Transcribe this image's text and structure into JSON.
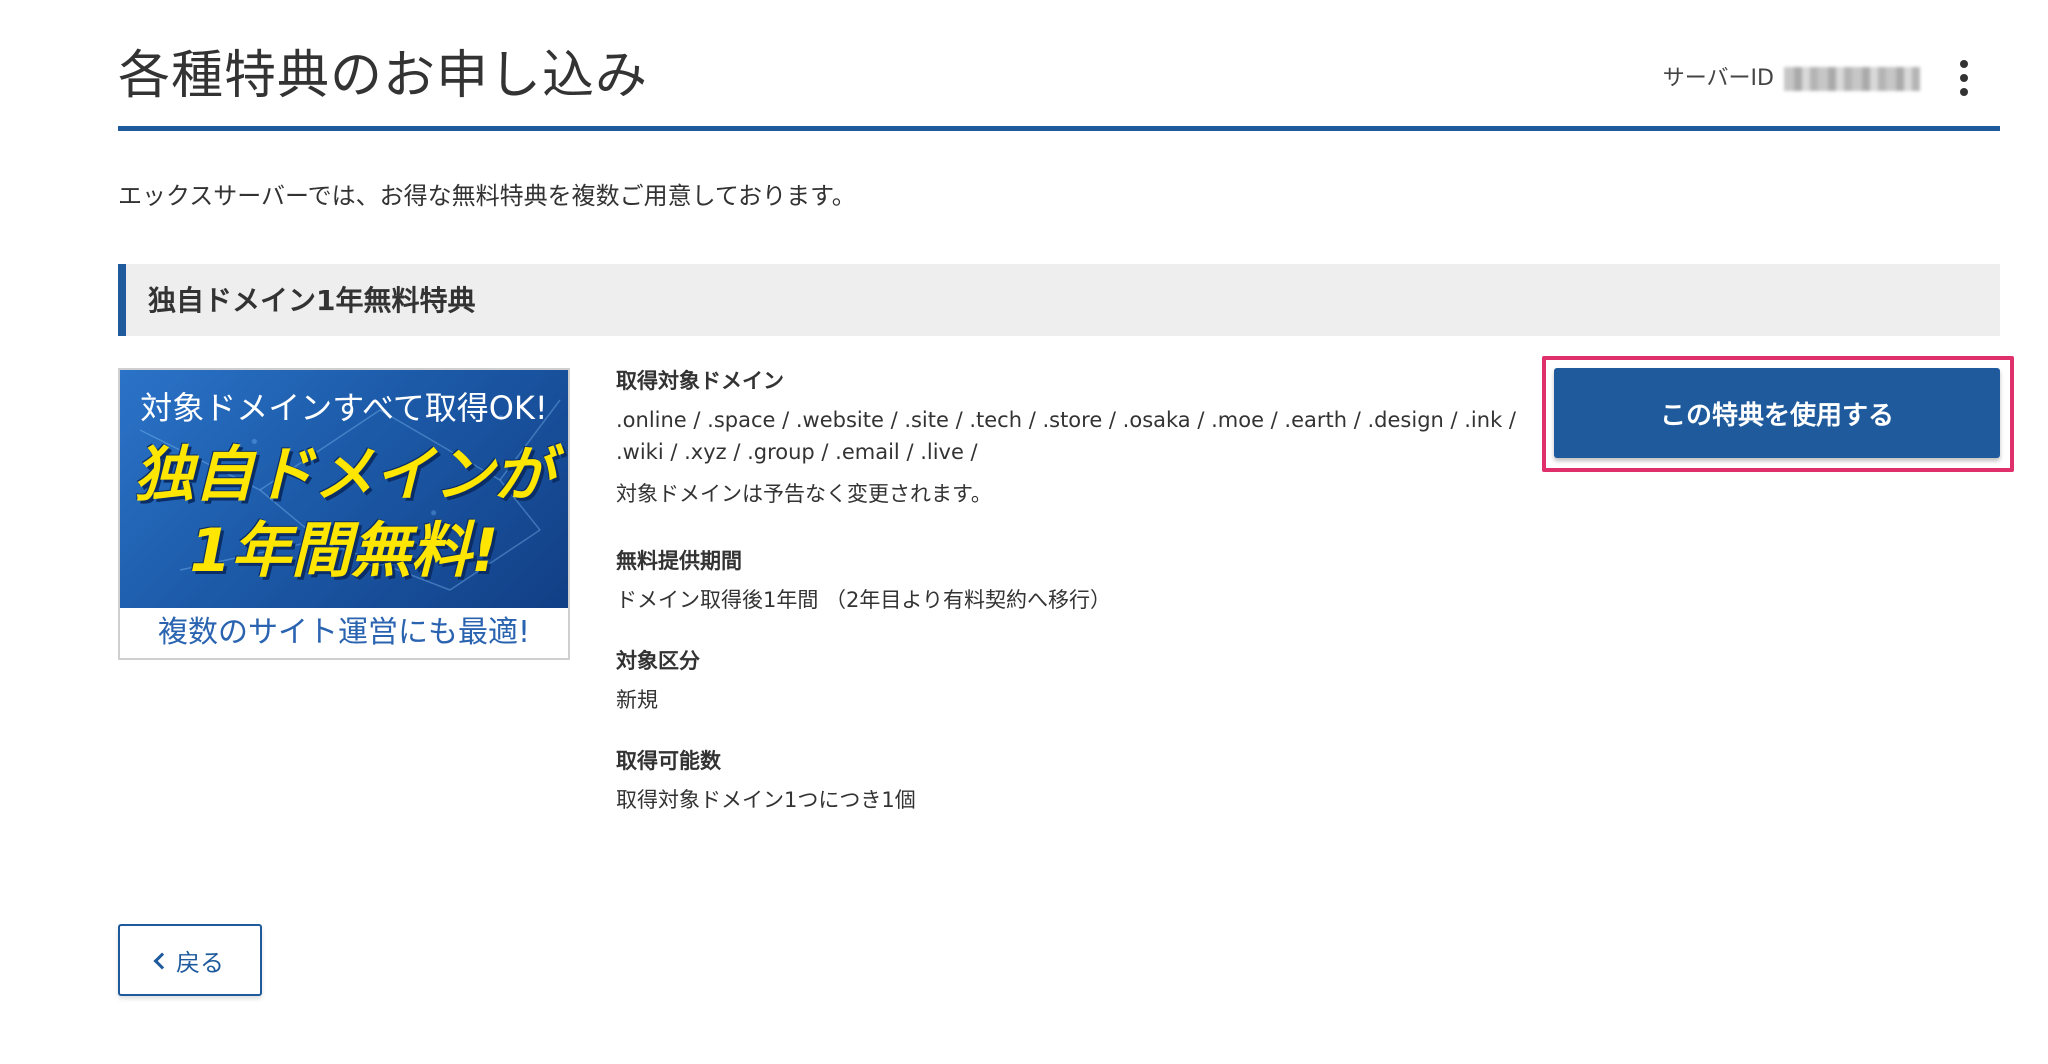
{
  "header": {
    "title": "各種特典のお申し込み",
    "server_id_label": "サーバーID",
    "menu_icon": "kebab-menu-icon"
  },
  "intro": "エックスサーバーでは、お得な無料特典を複数ご用意しております。",
  "section": {
    "title": "独自ドメイン1年無料特典",
    "banner": {
      "line1": "対象ドメインすべて取得OK!",
      "line2": "独自ドメインが",
      "line3": "1年間無料!",
      "line4": "複数のサイト運営にも最適!"
    },
    "details": {
      "target_domains": {
        "label": "取得対象ドメイン",
        "value": ".online / .space / .website / .site / .tech / .store / .osaka / .moe / .earth / .design / .ink / .wiki / .xyz / .group / .email / .live /",
        "note": "対象ドメインは予告なく変更されます。"
      },
      "free_period": {
        "label": "無料提供期間",
        "value": "ドメイン取得後1年間 （2年目より有料契約へ移行）"
      },
      "category": {
        "label": "対象区分",
        "value": "新規"
      },
      "quantity": {
        "label": "取得可能数",
        "value": "取得対象ドメイン1つにつき1個"
      }
    },
    "action_button": "この特典を使用する"
  },
  "back_button": "戻る",
  "colors": {
    "accent": "#1e5a9c",
    "highlight": "#e0306b",
    "section_bg": "#eeeeee"
  }
}
